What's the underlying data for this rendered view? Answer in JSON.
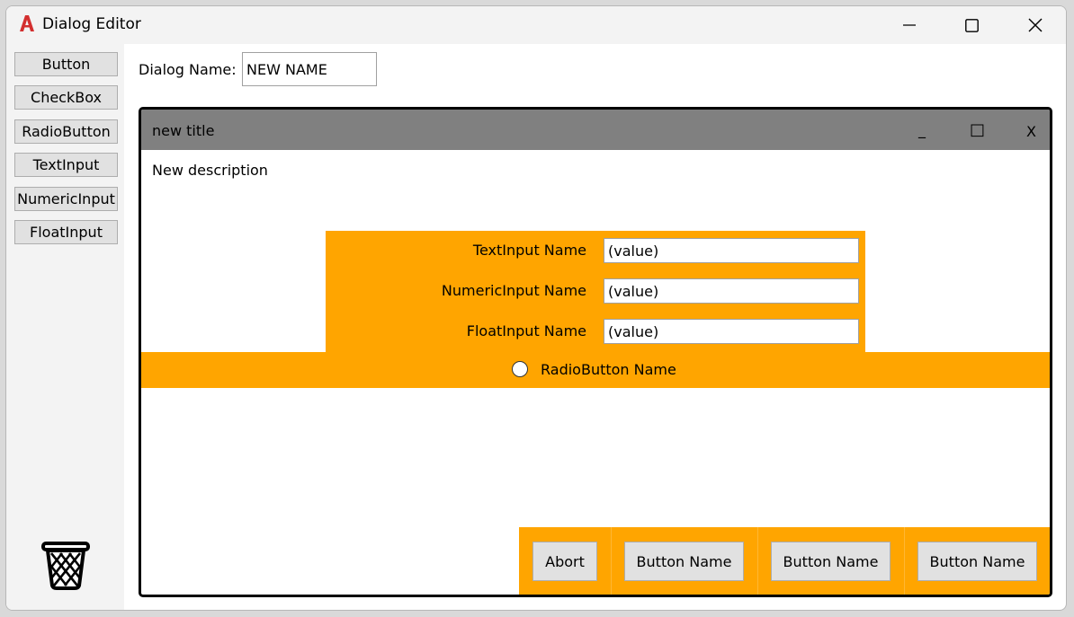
{
  "window": {
    "title": "Dialog Editor"
  },
  "sidebar": {
    "tools": [
      "Button",
      "CheckBox",
      "RadioButton",
      "TextInput",
      "NumericInput",
      "FloatInput"
    ]
  },
  "dialog_name": {
    "label": "Dialog Name:",
    "value": "NEW NAME"
  },
  "preview": {
    "title": "new title",
    "controls": {
      "minimize": "_",
      "maximize": "□",
      "close": "X"
    },
    "description": "New description",
    "fields": [
      {
        "label": "TextInput Name",
        "value": "(value)"
      },
      {
        "label": "NumericInput Name",
        "value": "(value)"
      },
      {
        "label": "FloatInput Name",
        "value": "(value)"
      }
    ],
    "radio": {
      "label": "RadioButton Name"
    },
    "buttons": [
      "Abort",
      "Button Name",
      "Button Name",
      "Button Name"
    ]
  },
  "colors": {
    "panel": "#ffa500",
    "preview_titlebar": "#808080"
  }
}
